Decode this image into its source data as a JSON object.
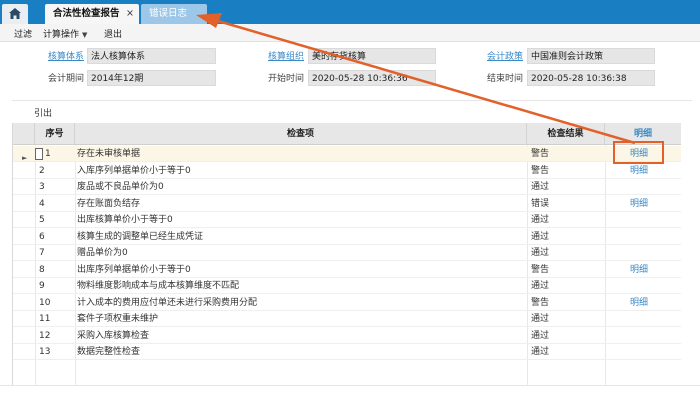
{
  "tabs": [
    {
      "label": "合法性检查报告",
      "close": "×"
    },
    {
      "label": "错误日志"
    }
  ],
  "toolbar": {
    "filter": "过滤",
    "calc_ops": "计算操作",
    "caret": "▼",
    "exit": "退出"
  },
  "form": {
    "acct_system_label": "核算体系",
    "acct_system_value": "法人核算体系",
    "acct_org_label": "核算组织",
    "acct_org_value": "美的存货核算",
    "acct_policy_label": "会计政策",
    "acct_policy_value": "中国准则会计政策",
    "period_label": "会计期间",
    "period_value": "2014年12期",
    "start_label": "开始时间",
    "start_value": "2020-05-28 10:36:36",
    "end_label": "结束时间",
    "end_value": "2020-05-28 10:36:38"
  },
  "sub_label": "引出",
  "grid": {
    "headers": [
      "序号",
      "检查项",
      "检查结果",
      "明细"
    ],
    "rows": [
      {
        "no": "1",
        "item": "存在未审核单据",
        "result": "警告",
        "detail": "明细"
      },
      {
        "no": "2",
        "item": "入库序列单据单价小于等于0",
        "result": "警告",
        "detail": "明细"
      },
      {
        "no": "3",
        "item": "废品或不良品单价为0",
        "result": "通过",
        "detail": ""
      },
      {
        "no": "4",
        "item": "存在账面负结存",
        "result": "错误",
        "detail": "明细"
      },
      {
        "no": "5",
        "item": "出库核算单价小于等于0",
        "result": "通过",
        "detail": ""
      },
      {
        "no": "6",
        "item": "核算生成的调整单已经生成凭证",
        "result": "通过",
        "detail": ""
      },
      {
        "no": "7",
        "item": "赠品单价为0",
        "result": "通过",
        "detail": ""
      },
      {
        "no": "8",
        "item": "出库序列单据单价小于等于0",
        "result": "警告",
        "detail": "明细"
      },
      {
        "no": "9",
        "item": "物料维度影响成本与成本核算维度不匹配",
        "result": "通过",
        "detail": ""
      },
      {
        "no": "10",
        "item": "计入成本的费用应付单还未进行采购费用分配",
        "result": "警告",
        "detail": "明细"
      },
      {
        "no": "11",
        "item": "套件子项权重未维护",
        "result": "通过",
        "detail": ""
      },
      {
        "no": "12",
        "item": "采购入库核算检查",
        "result": "通过",
        "detail": ""
      },
      {
        "no": "13",
        "item": "数据完整性检查",
        "result": "通过",
        "detail": ""
      }
    ]
  },
  "colors": {
    "tabbar": "#1a7ec3",
    "link": "#3a8ac8",
    "highlight": "#e2612a"
  },
  "icons": {
    "home": "home-icon",
    "row_cursor": "row-pointer-icon"
  }
}
